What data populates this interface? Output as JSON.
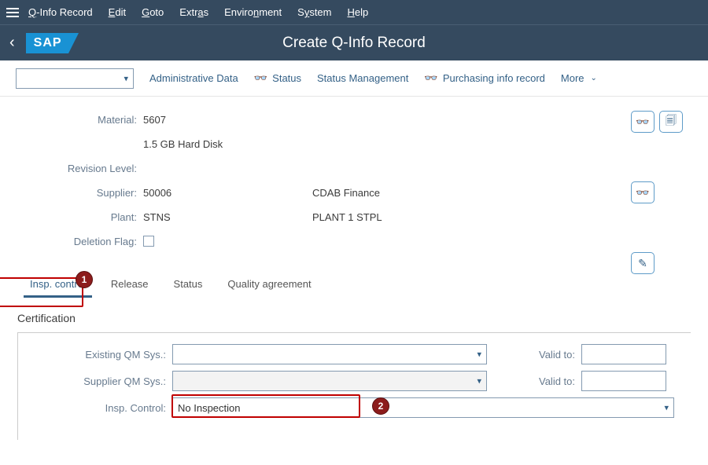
{
  "menu": {
    "items": [
      "Q-Info Record",
      "Edit",
      "Goto",
      "Extras",
      "Environment",
      "System",
      "Help"
    ]
  },
  "header": {
    "logo": "SAP",
    "title": "Create Q-Info Record"
  },
  "toolbar": {
    "admin_data": "Administrative Data",
    "status": "Status",
    "status_mgmt": "Status Management",
    "purch_info": "Purchasing info record",
    "more": "More"
  },
  "form": {
    "material_label": "Material:",
    "material_value": "5607",
    "material_desc": "1.5 GB Hard Disk",
    "revision_label": "Revision Level:",
    "supplier_label": "Supplier:",
    "supplier_value": "50006",
    "supplier_desc": "CDAB Finance",
    "plant_label": "Plant:",
    "plant_value": "STNS",
    "plant_desc": "PLANT 1 STPL",
    "deletion_label": "Deletion Flag:"
  },
  "tabs": {
    "insp": "Insp. control",
    "release": "Release",
    "status": "Status",
    "quality": "Quality agreement"
  },
  "cert": {
    "section": "Certification",
    "existing_label": "Existing QM Sys.:",
    "supplier_label": "Supplier QM Sys.:",
    "insp_label": "Insp. Control:",
    "insp_value": "No Inspection",
    "valid_to": "Valid to:"
  },
  "badges": {
    "b1": "1",
    "b2": "2"
  }
}
